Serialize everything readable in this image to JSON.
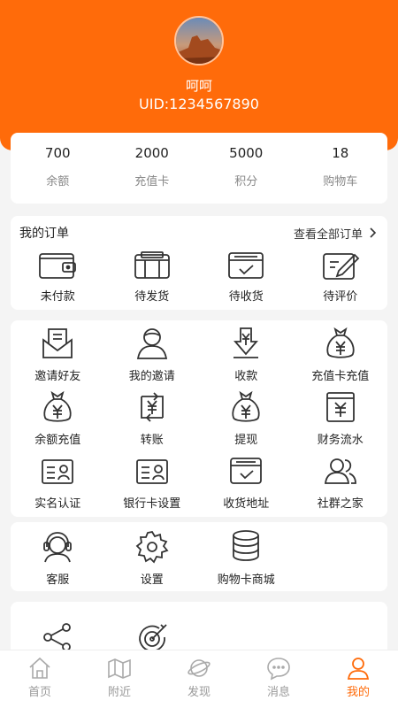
{
  "profile": {
    "name": "呵呵",
    "uid": "UID:1234567890"
  },
  "stats": [
    {
      "value": "700",
      "label": "余额"
    },
    {
      "value": "2000",
      "label": "充值卡"
    },
    {
      "value": "5000",
      "label": "积分"
    },
    {
      "value": "18",
      "label": "购物车"
    }
  ],
  "orders": {
    "title": "我的订单",
    "view_all": "查看全部订单",
    "items": [
      {
        "label": "未付款",
        "icon": "wallet-icon"
      },
      {
        "label": "待发货",
        "icon": "package-icon"
      },
      {
        "label": "待收货",
        "icon": "inbox-icon"
      },
      {
        "label": "待评价",
        "icon": "edit-icon"
      }
    ]
  },
  "services": [
    {
      "label": "邀请好友",
      "icon": "mail-invite-icon"
    },
    {
      "label": "我的邀请",
      "icon": "person-icon"
    },
    {
      "label": "收款",
      "icon": "download-yuan-icon"
    },
    {
      "label": "充值卡充值",
      "icon": "money-bag-icon"
    },
    {
      "label": "余额充值",
      "icon": "money-bag-icon"
    },
    {
      "label": "转账",
      "icon": "transfer-icon"
    },
    {
      "label": "提现",
      "icon": "money-bag-icon"
    },
    {
      "label": "财务流水",
      "icon": "ledger-icon"
    },
    {
      "label": "实名认证",
      "icon": "id-card-icon"
    },
    {
      "label": "银行卡设置",
      "icon": "id-card-icon"
    },
    {
      "label": "收货地址",
      "icon": "inbox-icon"
    },
    {
      "label": "社群之家",
      "icon": "group-icon"
    }
  ],
  "support": [
    {
      "label": "客服",
      "icon": "headset-icon"
    },
    {
      "label": "设置",
      "icon": "gear-icon"
    },
    {
      "label": "购物卡商城",
      "icon": "coin-stack-icon"
    }
  ],
  "more": [
    {
      "icon": "share-icon"
    },
    {
      "icon": "target-icon"
    }
  ],
  "tabs": [
    {
      "label": "首页",
      "icon": "home-icon",
      "active": false
    },
    {
      "label": "附近",
      "icon": "map-icon",
      "active": false
    },
    {
      "label": "发现",
      "icon": "planet-icon",
      "active": false
    },
    {
      "label": "消息",
      "icon": "chat-icon",
      "active": false
    },
    {
      "label": "我的",
      "icon": "user-icon",
      "active": true
    }
  ],
  "colors": {
    "accent": "#ff6b0a",
    "background": "#f4f4f4",
    "icon": "#333333",
    "tab_inactive": "#999999"
  }
}
